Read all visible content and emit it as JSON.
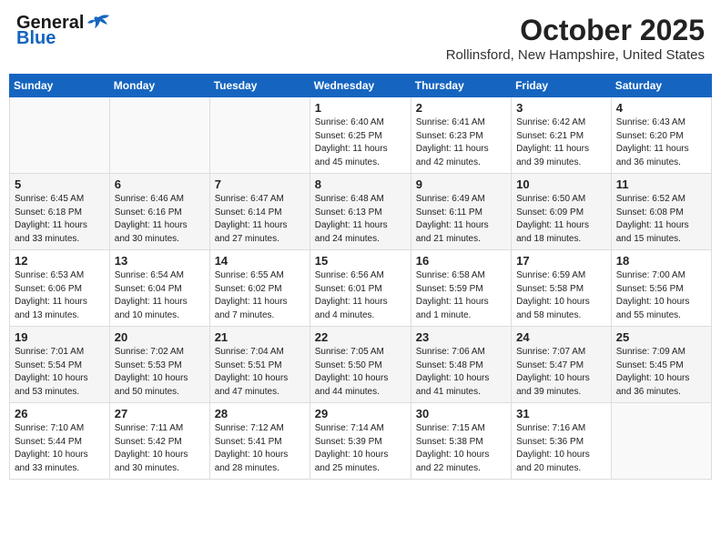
{
  "header": {
    "logo_general": "General",
    "logo_blue": "Blue",
    "month": "October 2025",
    "location": "Rollinsford, New Hampshire, United States"
  },
  "weekdays": [
    "Sunday",
    "Monday",
    "Tuesday",
    "Wednesday",
    "Thursday",
    "Friday",
    "Saturday"
  ],
  "weeks": [
    [
      {
        "day": "",
        "info": ""
      },
      {
        "day": "",
        "info": ""
      },
      {
        "day": "",
        "info": ""
      },
      {
        "day": "1",
        "info": "Sunrise: 6:40 AM\nSunset: 6:25 PM\nDaylight: 11 hours\nand 45 minutes."
      },
      {
        "day": "2",
        "info": "Sunrise: 6:41 AM\nSunset: 6:23 PM\nDaylight: 11 hours\nand 42 minutes."
      },
      {
        "day": "3",
        "info": "Sunrise: 6:42 AM\nSunset: 6:21 PM\nDaylight: 11 hours\nand 39 minutes."
      },
      {
        "day": "4",
        "info": "Sunrise: 6:43 AM\nSunset: 6:20 PM\nDaylight: 11 hours\nand 36 minutes."
      }
    ],
    [
      {
        "day": "5",
        "info": "Sunrise: 6:45 AM\nSunset: 6:18 PM\nDaylight: 11 hours\nand 33 minutes."
      },
      {
        "day": "6",
        "info": "Sunrise: 6:46 AM\nSunset: 6:16 PM\nDaylight: 11 hours\nand 30 minutes."
      },
      {
        "day": "7",
        "info": "Sunrise: 6:47 AM\nSunset: 6:14 PM\nDaylight: 11 hours\nand 27 minutes."
      },
      {
        "day": "8",
        "info": "Sunrise: 6:48 AM\nSunset: 6:13 PM\nDaylight: 11 hours\nand 24 minutes."
      },
      {
        "day": "9",
        "info": "Sunrise: 6:49 AM\nSunset: 6:11 PM\nDaylight: 11 hours\nand 21 minutes."
      },
      {
        "day": "10",
        "info": "Sunrise: 6:50 AM\nSunset: 6:09 PM\nDaylight: 11 hours\nand 18 minutes."
      },
      {
        "day": "11",
        "info": "Sunrise: 6:52 AM\nSunset: 6:08 PM\nDaylight: 11 hours\nand 15 minutes."
      }
    ],
    [
      {
        "day": "12",
        "info": "Sunrise: 6:53 AM\nSunset: 6:06 PM\nDaylight: 11 hours\nand 13 minutes."
      },
      {
        "day": "13",
        "info": "Sunrise: 6:54 AM\nSunset: 6:04 PM\nDaylight: 11 hours\nand 10 minutes."
      },
      {
        "day": "14",
        "info": "Sunrise: 6:55 AM\nSunset: 6:02 PM\nDaylight: 11 hours\nand 7 minutes."
      },
      {
        "day": "15",
        "info": "Sunrise: 6:56 AM\nSunset: 6:01 PM\nDaylight: 11 hours\nand 4 minutes."
      },
      {
        "day": "16",
        "info": "Sunrise: 6:58 AM\nSunset: 5:59 PM\nDaylight: 11 hours\nand 1 minute."
      },
      {
        "day": "17",
        "info": "Sunrise: 6:59 AM\nSunset: 5:58 PM\nDaylight: 10 hours\nand 58 minutes."
      },
      {
        "day": "18",
        "info": "Sunrise: 7:00 AM\nSunset: 5:56 PM\nDaylight: 10 hours\nand 55 minutes."
      }
    ],
    [
      {
        "day": "19",
        "info": "Sunrise: 7:01 AM\nSunset: 5:54 PM\nDaylight: 10 hours\nand 53 minutes."
      },
      {
        "day": "20",
        "info": "Sunrise: 7:02 AM\nSunset: 5:53 PM\nDaylight: 10 hours\nand 50 minutes."
      },
      {
        "day": "21",
        "info": "Sunrise: 7:04 AM\nSunset: 5:51 PM\nDaylight: 10 hours\nand 47 minutes."
      },
      {
        "day": "22",
        "info": "Sunrise: 7:05 AM\nSunset: 5:50 PM\nDaylight: 10 hours\nand 44 minutes."
      },
      {
        "day": "23",
        "info": "Sunrise: 7:06 AM\nSunset: 5:48 PM\nDaylight: 10 hours\nand 41 minutes."
      },
      {
        "day": "24",
        "info": "Sunrise: 7:07 AM\nSunset: 5:47 PM\nDaylight: 10 hours\nand 39 minutes."
      },
      {
        "day": "25",
        "info": "Sunrise: 7:09 AM\nSunset: 5:45 PM\nDaylight: 10 hours\nand 36 minutes."
      }
    ],
    [
      {
        "day": "26",
        "info": "Sunrise: 7:10 AM\nSunset: 5:44 PM\nDaylight: 10 hours\nand 33 minutes."
      },
      {
        "day": "27",
        "info": "Sunrise: 7:11 AM\nSunset: 5:42 PM\nDaylight: 10 hours\nand 30 minutes."
      },
      {
        "day": "28",
        "info": "Sunrise: 7:12 AM\nSunset: 5:41 PM\nDaylight: 10 hours\nand 28 minutes."
      },
      {
        "day": "29",
        "info": "Sunrise: 7:14 AM\nSunset: 5:39 PM\nDaylight: 10 hours\nand 25 minutes."
      },
      {
        "day": "30",
        "info": "Sunrise: 7:15 AM\nSunset: 5:38 PM\nDaylight: 10 hours\nand 22 minutes."
      },
      {
        "day": "31",
        "info": "Sunrise: 7:16 AM\nSunset: 5:36 PM\nDaylight: 10 hours\nand 20 minutes."
      },
      {
        "day": "",
        "info": ""
      }
    ]
  ]
}
